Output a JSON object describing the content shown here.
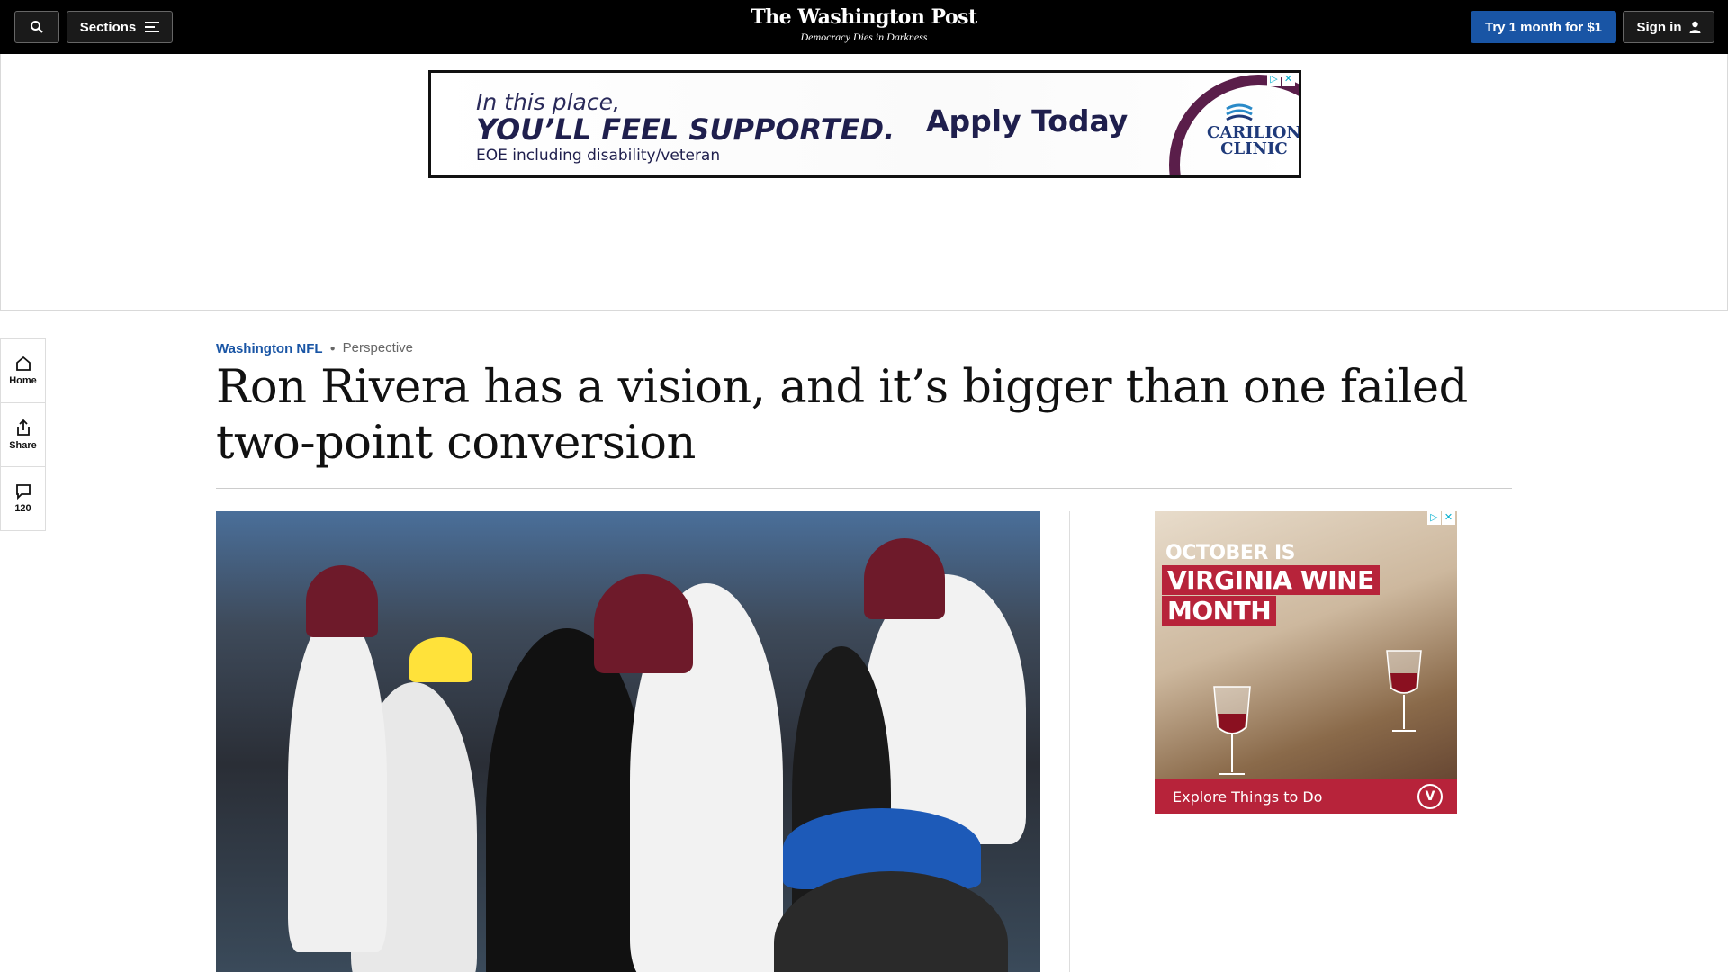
{
  "header": {
    "sections_label": "Sections",
    "logo_title": "The Washington Post",
    "logo_tagline": "Democracy Dies in Darkness",
    "subscribe_label": "Try 1 month for $1",
    "signin_label": "Sign in"
  },
  "top_ad": {
    "line1": "In this place,",
    "line2": "YOU’LL FEEL SUPPORTED.",
    "line3": "EOE including disability/veteran",
    "cta": "Apply Today",
    "brand_line1": "CARILION",
    "brand_line2": "CLINIC"
  },
  "rail": {
    "home_label": "Home",
    "share_label": "Share",
    "comments_count": "120"
  },
  "article": {
    "section": "Washington NFL",
    "label": "Perspective",
    "headline": "Ron Rivera has a vision, and it’s bigger than one failed two-point conversion"
  },
  "side_ad": {
    "line1": "OCTOBER IS",
    "line2": "VIRGINIA WINE",
    "line3": "MONTH",
    "cta": "Explore Things to Do",
    "logo_text": "V"
  },
  "colors": {
    "nav_bg": "#000000",
    "accent_blue": "#1955a5",
    "ad_red": "#b7233a",
    "team_burgundy": "#6e1a2a",
    "team_gold": "#ffb612"
  }
}
